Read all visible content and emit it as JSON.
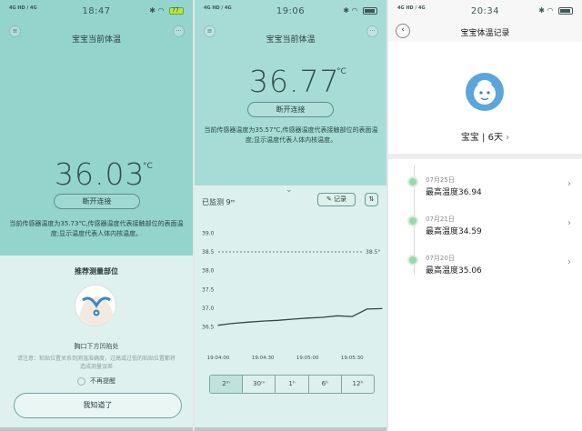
{
  "screens": [
    {
      "status": {
        "signal": "4G HD / 4G",
        "time": "18:47",
        "battery": "77"
      },
      "title": "宝宝当前体温",
      "temperature": "36.03",
      "unit": "°C",
      "disconnect": "断开连接",
      "note": "当前传感器温度为35.73℃,传感器温度代表接触部位的表面温度;显示温度代表人体内核温度。",
      "section_title": "推荐测量部位",
      "position_label": "胸口下方凹陷处",
      "tip": "请注意：粘贴位置关系到测温准确度，过高或过低的粘贴位置都将造成测量误差",
      "no_remind": "不再提醒",
      "confirm": "我知道了"
    },
    {
      "status": {
        "signal": "4G HD / 4G",
        "time": "19:06"
      },
      "title": "宝宝当前体温",
      "temperature": "36.77",
      "unit": "°C",
      "disconnect": "断开连接",
      "note": "当前传感器温度为35.57℃,传感器温度代表接触部位的表面温度;显示温度代表人体内核温度。",
      "monitored": "已监测",
      "monitored_value": "9ᵐ",
      "record_button": "记录",
      "threshold_label": "38.5°",
      "range_tabs": [
        "2ᵐ",
        "30ᵐ",
        "1ʰ",
        "6ʰ",
        "12ʰ"
      ],
      "active_tab": 0
    },
    {
      "status": {
        "signal": "4G HD / 4G",
        "time": "20:34"
      },
      "title": "宝宝体温记录",
      "profile": "宝宝 | 6天",
      "records": [
        {
          "date": "07月25日",
          "value": "最高温度36.94"
        },
        {
          "date": "07月21日",
          "value": "最高温度34.59"
        },
        {
          "date": "07月20日",
          "value": "最高温度35.06"
        }
      ]
    }
  ],
  "chart_data": {
    "type": "line",
    "x": [
      "19:04:00",
      "19:04:10",
      "19:04:20",
      "19:04:30",
      "19:04:40",
      "19:04:50",
      "19:05:00",
      "19:05:10",
      "19:05:20",
      "19:05:30",
      "19:05:40",
      "19:05:50"
    ],
    "series": [
      {
        "values": [
          36.55,
          36.6,
          36.63,
          36.66,
          36.68,
          36.71,
          36.74,
          36.76,
          36.8,
          36.78,
          36.98,
          36.99
        ]
      }
    ],
    "x_tick_labels": [
      "19:04:00",
      "19:04:30",
      "19:05:00",
      "19:05:30"
    ],
    "y_tick_labels": [
      "36.5",
      "37.0",
      "37.5",
      "38.0",
      "38.5",
      "39.0"
    ],
    "ylim": [
      36.3,
      39.2
    ],
    "threshold": 38.5,
    "color": "#2e4a48"
  }
}
